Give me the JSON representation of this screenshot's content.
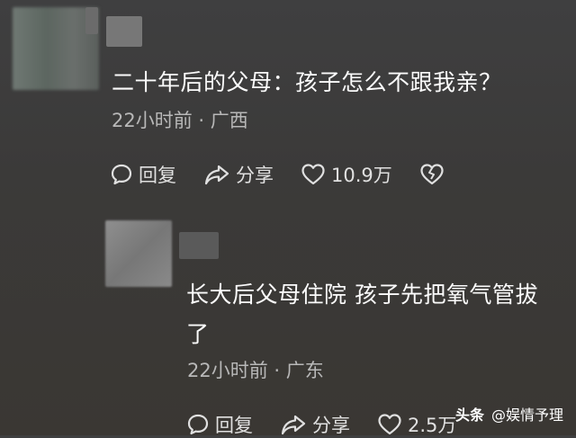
{
  "comment": {
    "text": "二十年后的父母：孩子怎么不跟我亲？",
    "meta": "22小时前 · 广西",
    "actions": {
      "reply": "回复",
      "share": "分享",
      "likes": "10.9万"
    }
  },
  "reply": {
    "text_line1": "长大后父母住院 孩子先把氧气管拔",
    "text_line2": "了",
    "meta": "22小时前 · 广东",
    "actions": {
      "reply": "回复",
      "share": "分享",
      "likes": "2.5万"
    }
  },
  "watermark": {
    "brand": "头条",
    "handle": "@娱情予理"
  },
  "icons": [
    "comment-icon",
    "share-icon",
    "heart-icon",
    "broken-heart-icon"
  ]
}
